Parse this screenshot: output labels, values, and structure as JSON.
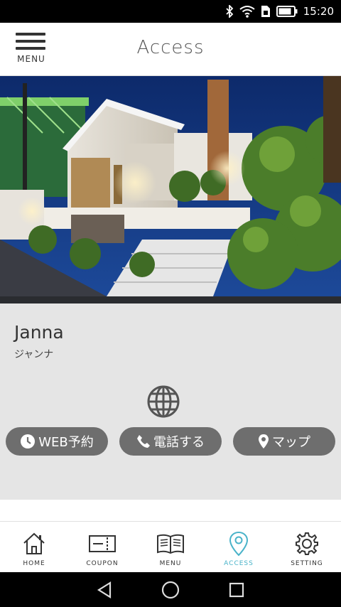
{
  "status_bar": {
    "time": "15:20"
  },
  "header": {
    "menu_label": "MENU",
    "title": "Access"
  },
  "shop": {
    "name": "Janna",
    "kana": "ジャンナ"
  },
  "actions": {
    "web_reserve": "WEB予約",
    "call": "電話する",
    "map": "マップ"
  },
  "tabs": [
    {
      "label": "HOME",
      "icon": "home-icon"
    },
    {
      "label": "COUPON",
      "icon": "coupon-icon"
    },
    {
      "label": "MENU",
      "icon": "book-icon"
    },
    {
      "label": "ACCESS",
      "icon": "location-pin-icon"
    },
    {
      "label": "SETTING",
      "icon": "gear-icon"
    }
  ],
  "colors": {
    "accent": "#4ab3c9",
    "button": "#6e6e6e",
    "content_bg": "#e5e5e5"
  }
}
